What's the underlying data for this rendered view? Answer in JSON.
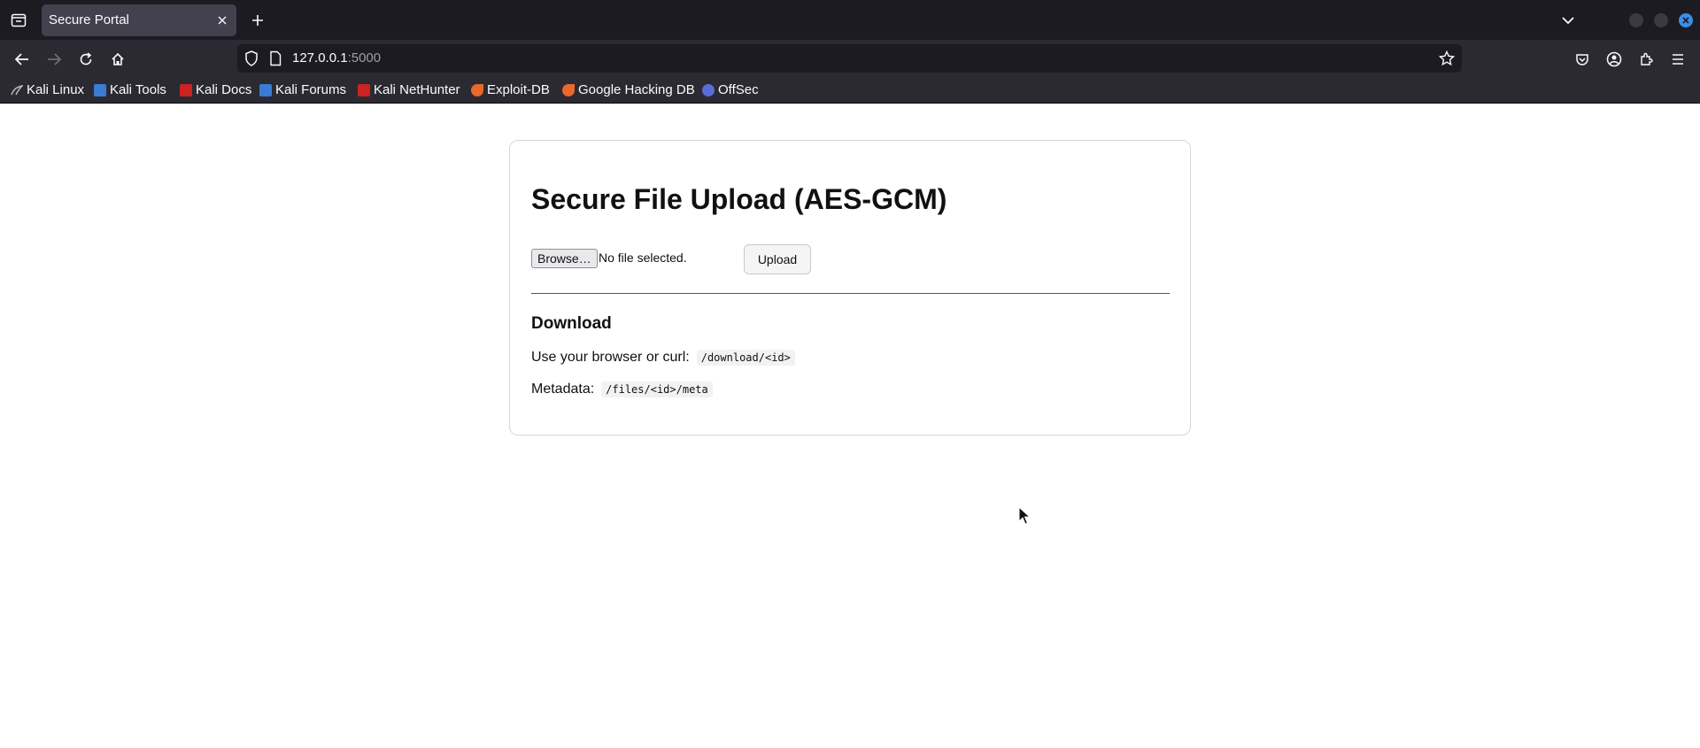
{
  "browser": {
    "tab_title": "Secure Portal",
    "url_host": "127.0.0.1",
    "url_port": ":5000",
    "bookmarks": [
      {
        "label": "Kali Linux",
        "icon": "kali-linux-icon",
        "color": "#4a4a4a"
      },
      {
        "label": "Kali Tools",
        "icon": "kali-tools-icon",
        "color": "#3a7bd5"
      },
      {
        "label": "Kali Docs",
        "icon": "kali-docs-icon",
        "color": "#cc2222"
      },
      {
        "label": "Kali Forums",
        "icon": "kali-forums-icon",
        "color": "#3a7bd5"
      },
      {
        "label": "Kali NetHunter",
        "icon": "kali-nethunter-icon",
        "color": "#cc2222"
      },
      {
        "label": "Exploit-DB",
        "icon": "exploit-db-icon",
        "color": "#e8692a"
      },
      {
        "label": "Google Hacking DB",
        "icon": "google-hacking-db-icon",
        "color": "#e8692a"
      },
      {
        "label": "OffSec",
        "icon": "offsec-icon",
        "color": "#5b6cd6"
      }
    ]
  },
  "page": {
    "heading": "Secure File Upload (AES-GCM)",
    "browse_label": "Browse…",
    "file_status": "No file selected.",
    "upload_label": "Upload",
    "download_heading": "Download",
    "download_text": "Use your browser or curl:",
    "download_path": "/download/<id>",
    "metadata_text": "Metadata:",
    "metadata_path": "/files/<id>/meta"
  },
  "colors": {
    "accent": "#3b8eea",
    "chrome_dark": "#1c1b22",
    "chrome": "#2b2a33"
  }
}
